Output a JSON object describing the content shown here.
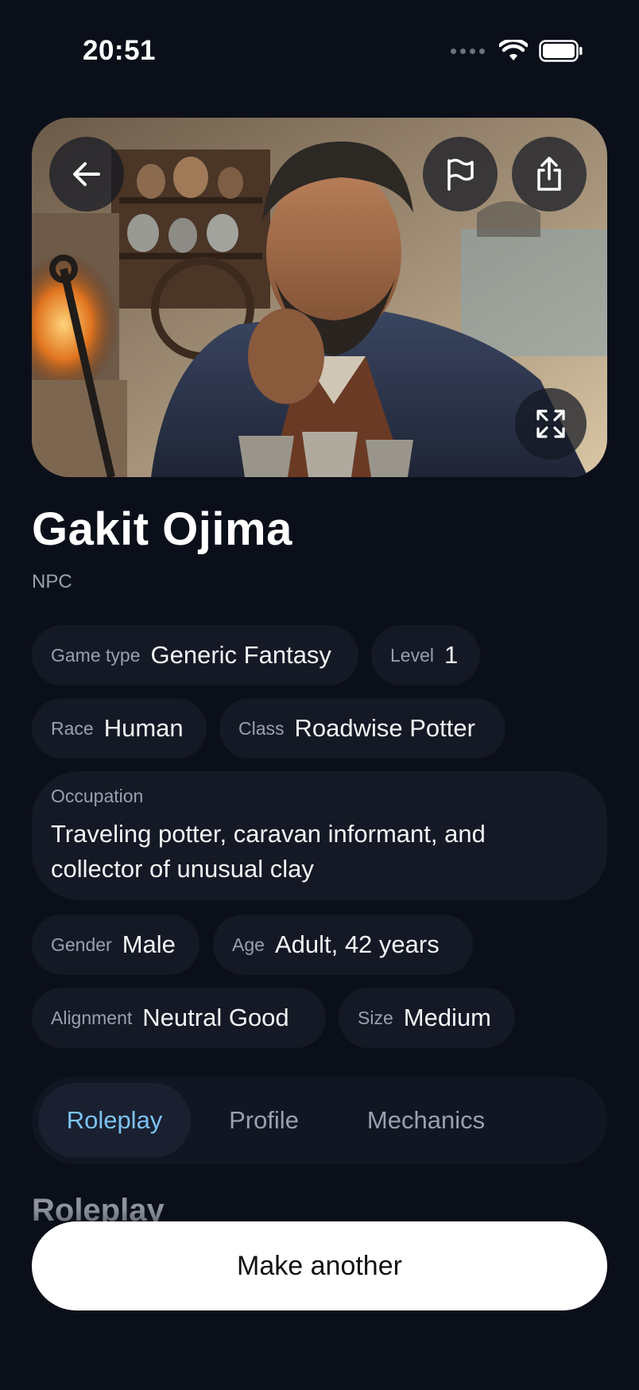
{
  "status_bar": {
    "time": "20:51"
  },
  "character": {
    "name": "Gakit Ojima",
    "type": "NPC"
  },
  "attributes": {
    "game_type": {
      "label": "Game type",
      "value": "Generic Fantasy"
    },
    "level": {
      "label": "Level",
      "value": "1"
    },
    "race": {
      "label": "Race",
      "value": "Human"
    },
    "class": {
      "label": "Class",
      "value": "Roadwise Potter"
    },
    "occupation": {
      "label": "Occupation",
      "value": "Traveling potter, caravan informant, and collector of unusual clay"
    },
    "gender": {
      "label": "Gender",
      "value": "Male"
    },
    "age": {
      "label": "Age",
      "value": "Adult, 42 years"
    },
    "alignment": {
      "label": "Alignment",
      "value": "Neutral Good"
    },
    "size": {
      "label": "Size",
      "value": "Medium"
    }
  },
  "tabs": [
    {
      "label": "Roleplay",
      "active": true
    },
    {
      "label": "Profile",
      "active": false
    },
    {
      "label": "Mechanics",
      "active": false
    }
  ],
  "section": {
    "heading": "Roleplay"
  },
  "actions": {
    "make_another": "Make another"
  },
  "icons": {
    "back": "arrow-left-icon",
    "report": "flag-icon",
    "share": "share-icon",
    "expand": "expand-icon"
  },
  "colors": {
    "background": "#0b0f19",
    "chip_background": "#141925",
    "active_tab_text": "#7cc3f2",
    "button_background": "#ffffff"
  }
}
